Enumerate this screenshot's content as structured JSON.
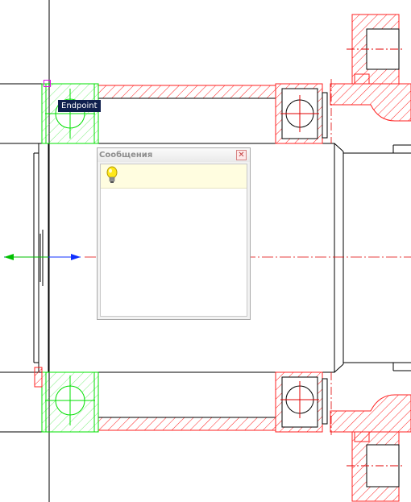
{
  "tooltip": {
    "text": "Endpoint"
  },
  "messages_window": {
    "title": "Сообщения",
    "close_icon": "close-icon",
    "rows": [
      {
        "icon": "lightbulb-icon",
        "text": ""
      }
    ]
  },
  "colors": {
    "geometry": "#000000",
    "hatch": "#ff2020",
    "centerline": "#e00000",
    "selection": "#00e000",
    "grip": "#e010e0",
    "axis_x": "#1030ff",
    "axis_y": "#00c000"
  }
}
